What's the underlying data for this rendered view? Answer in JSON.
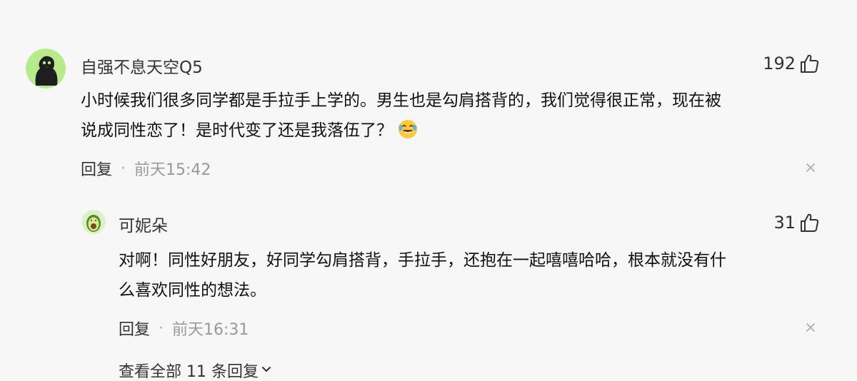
{
  "comment": {
    "username": "自强不息天空Q5",
    "likes": "192",
    "text_line1": "小时候我们很多同学都是手拉手上学的。男生也是勾肩搭背的，我们觉得很正常，现在被",
    "text_line2": "说成同性恋了！是时代变了还是我落伍了？",
    "reply_label": "回复",
    "separator": "·",
    "time": "前天15:42"
  },
  "reply": {
    "username": "可妮朵",
    "likes": "31",
    "text_line1": "对啊！同性好朋友，好同学勾肩搭背，手拉手，还抱在一起嘻嘻哈哈，根本就没有什",
    "text_line2": "么喜欢同性的想法。",
    "reply_label": "回复",
    "separator": "·",
    "time": "前天16:31"
  },
  "view_all_label": "查看全部 11 条回复",
  "icons": {
    "like": "thumbs-up-icon",
    "close": "close-icon",
    "expand": "chevron-down-icon",
    "emoji": "laughing-tears-emoji-icon"
  }
}
